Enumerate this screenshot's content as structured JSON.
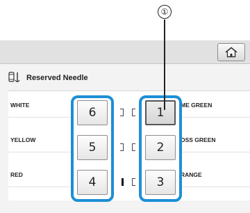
{
  "callout": {
    "number": "①"
  },
  "topbar": {
    "home_icon": "home-icon"
  },
  "header": {
    "icon": "spool-needle-icon",
    "title": "Reserved Needle"
  },
  "left_labels": [
    "WHITE",
    "YELLOW",
    "RED"
  ],
  "right_labels": [
    "ME GREEN",
    "OSS GREEN",
    "RANGE"
  ],
  "left_buttons": [
    "6",
    "5",
    "4"
  ],
  "right_buttons": [
    "1",
    "2",
    "3"
  ],
  "colors": {
    "group_highlight": "#1d8fd6",
    "callout": "#222222"
  }
}
